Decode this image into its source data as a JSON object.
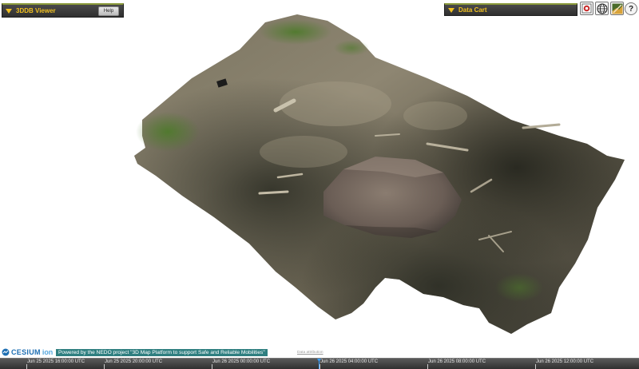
{
  "viewer_panel": {
    "title": "3DDB Viewer",
    "help_label": "Help"
  },
  "cart_panel": {
    "title": "Data Cart"
  },
  "toolbar": {
    "buttons": [
      {
        "icon": "home-icon"
      },
      {
        "icon": "globe-icon"
      },
      {
        "icon": "map-layers-icon"
      },
      {
        "icon": "help-icon",
        "glyph": "?"
      }
    ]
  },
  "credits": {
    "cesium": "CESIUM",
    "ion": "ion",
    "powered_by": "Powered by the NEDO project \"3D Map Platform to support Safe and Reliable Mobilities\"",
    "data_attribution": "Data attribution"
  },
  "timeline": {
    "labels": [
      "Jun 25 2025 16:00:00 UTC",
      "Jun 25 2025 20:00:00 UTC",
      "Jun 26 2025 00:00:00 UTC",
      "Jun 26 2025 04:00:00 UTC",
      "Jun 26 2025 08:00:00 UTC",
      "Jun 26 2025 12:00:00 UTC"
    ]
  },
  "colors": {
    "panel_title": "#f0c020",
    "panel_bg": "#3a3a3a",
    "accent_line": "#8a9a3a",
    "cesium_blue": "#1e6fb3",
    "nedo_bg": "#2f7f80"
  }
}
